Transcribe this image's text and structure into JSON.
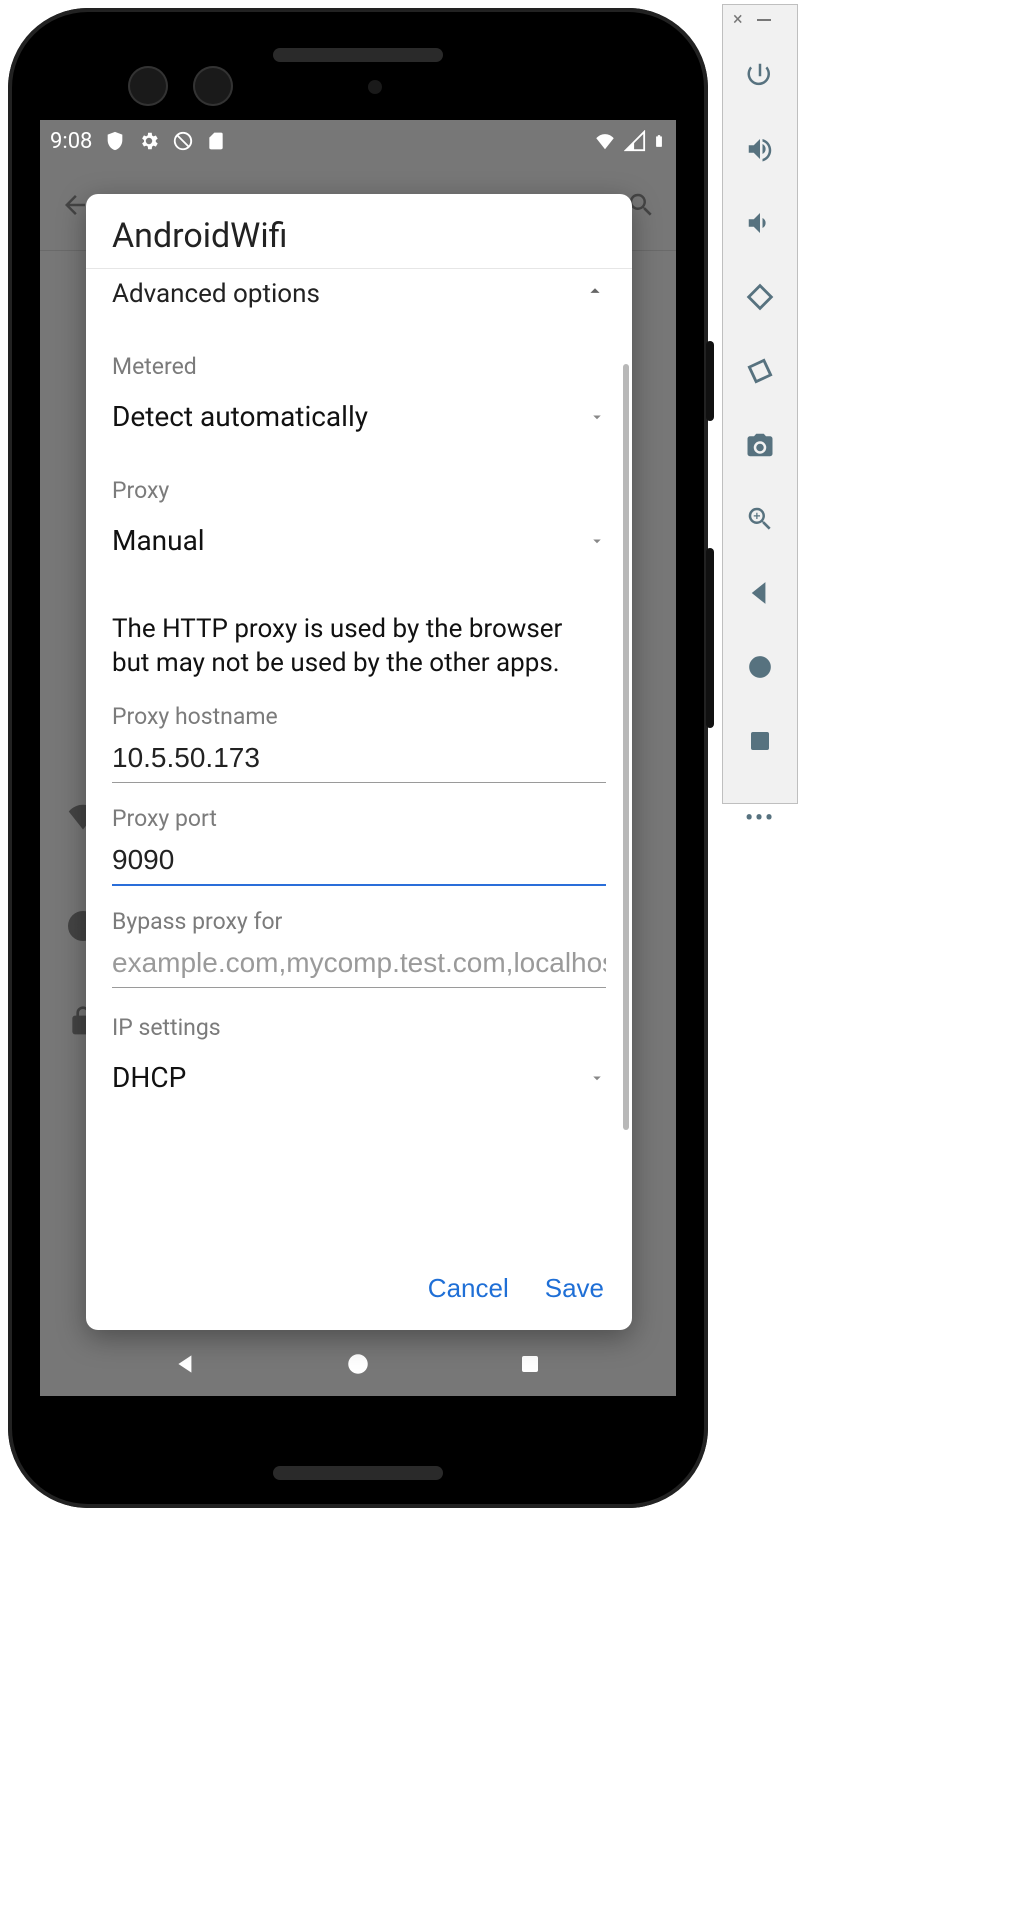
{
  "status": {
    "time": "9:08"
  },
  "dialog": {
    "title": "AndroidWifi",
    "advanced_label": "Advanced options",
    "metered_label": "Metered",
    "metered_value": "Detect automatically",
    "proxy_label": "Proxy",
    "proxy_value": "Manual",
    "proxy_info": "The HTTP proxy is used by the browser but may not be used by the other apps.",
    "hostname_label": "Proxy hostname",
    "hostname_value": "10.5.50.173",
    "port_label": "Proxy port",
    "port_value": "9090",
    "bypass_label": "Bypass proxy for",
    "bypass_placeholder": "example.com,mycomp.test.com,localhost",
    "ip_label": "IP settings",
    "ip_value": "DHCP",
    "cancel": "Cancel",
    "save": "Save"
  }
}
